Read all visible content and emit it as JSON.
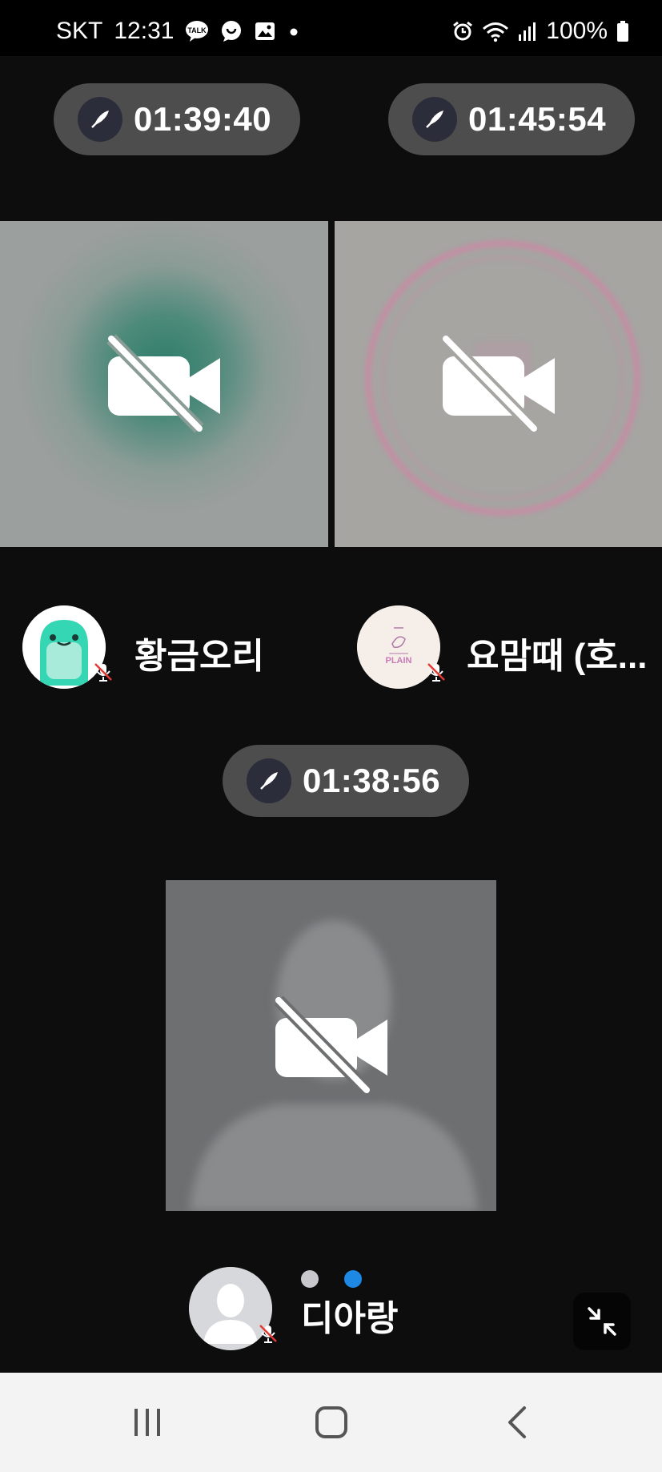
{
  "status_bar": {
    "carrier": "SKT",
    "time": "12:31",
    "talk_badge": "TALK",
    "battery": "100%"
  },
  "participants": [
    {
      "name": "황금오리",
      "timer": "01:39:40",
      "camera": "off",
      "mic": "muted"
    },
    {
      "name": "요맘때 (호...",
      "timer": "01:45:54",
      "camera": "off",
      "mic": "muted",
      "avatar_text": "PLAIN"
    },
    {
      "name": "디아랑",
      "timer": "01:38:56",
      "camera": "off",
      "mic": "muted"
    }
  ],
  "colors": {
    "background": "#0d0d0d",
    "pill": "#4d4d4d",
    "speaking_dot_active": "#1e88e5",
    "speaking_dot_inactive": "#c7c7cc"
  },
  "icons": {
    "camera_off": "video-off-icon",
    "timer": "rocket-icon",
    "mute": "mic-off-icon",
    "minimize": "collapse-icon"
  },
  "navigation": [
    "recent-apps",
    "home",
    "back"
  ]
}
